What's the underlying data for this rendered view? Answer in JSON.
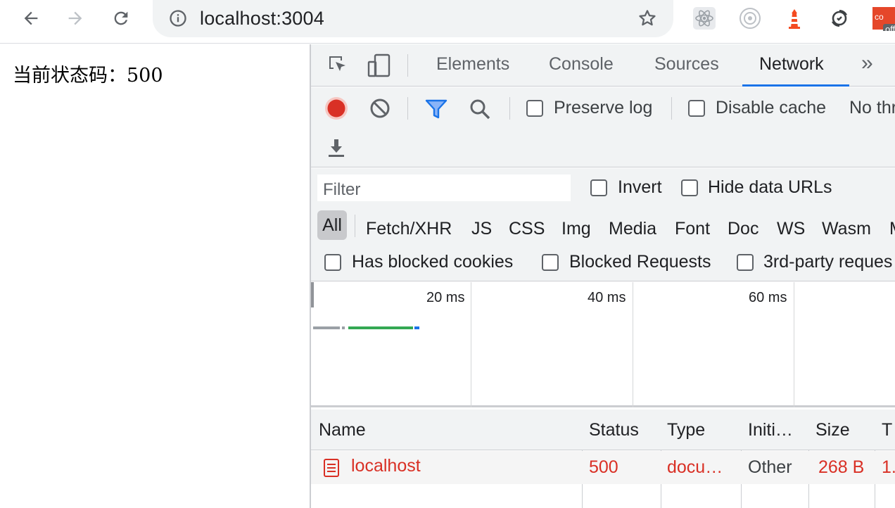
{
  "browser": {
    "url": "localhost:3004",
    "nav": {
      "back": "back-arrow-icon",
      "forward": "forward-arrow-icon",
      "reload": "reload-icon"
    },
    "extensions": [
      "react-devtools-icon",
      "redux-devtools-icon",
      "lighthouse-icon",
      "sync-icon"
    ],
    "extension_badge": "off"
  },
  "page": {
    "status_text": "当前状态码：500"
  },
  "devtools": {
    "tabs": [
      "Elements",
      "Console",
      "Sources",
      "Network"
    ],
    "active_tab": "Network",
    "more_tabs_glyph": "»",
    "toolbar": {
      "preserve_log": "Preserve log",
      "disable_cache": "Disable cache",
      "throttling": "No thr"
    },
    "filter": {
      "placeholder": "Filter",
      "invert": "Invert",
      "hide_data_urls": "Hide data URLs",
      "types": [
        "All",
        "Fetch/XHR",
        "JS",
        "CSS",
        "Img",
        "Media",
        "Font",
        "Doc",
        "WS",
        "Wasm",
        "M"
      ],
      "has_blocked_cookies": "Has blocked cookies",
      "blocked_requests": "Blocked Requests",
      "third_party": "3rd-party reques"
    },
    "overview": {
      "ticks": [
        "20 ms",
        "40 ms",
        "60 ms"
      ]
    },
    "table": {
      "columns": [
        "Name",
        "Status",
        "Type",
        "Initi…",
        "Size",
        "T"
      ],
      "rows": [
        {
          "name": "localhost",
          "status": "500",
          "type": "docu…",
          "initiator": "Other",
          "size": "268 B",
          "time": "1."
        }
      ]
    },
    "colors": {
      "accent": "#1a73e8",
      "record": "#d93025",
      "error_text": "#d93025",
      "waterfall_green": "#34a853",
      "waterfall_blue": "#1a73e8",
      "waterfall_gray": "#9aa0a6"
    }
  }
}
